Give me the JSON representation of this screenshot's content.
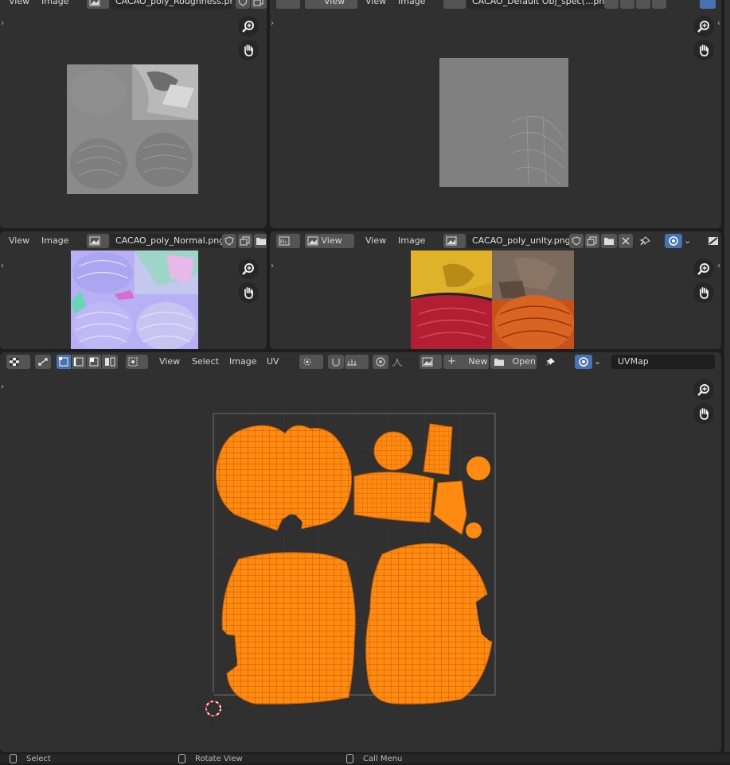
{
  "colors": {
    "uv_fill": "#ff8a12",
    "uv_edge": "#c45c00",
    "canvas": "#303030",
    "header": "#303030",
    "accent_blue": "#4772b3"
  },
  "panels": {
    "roughness": {
      "menus": [
        "View",
        "Image"
      ],
      "image_name": "CACAO_poly_Roughness.png"
    },
    "specular": {
      "menus": [
        "View",
        "Image"
      ],
      "view_dropdown": "View",
      "image_name": "CACAO_Default Obj_spec(...png"
    },
    "normal": {
      "menus": [
        "View",
        "Image"
      ],
      "image_name": "CACAO_poly_Normal.png"
    },
    "unity": {
      "menus": [
        "View",
        "Image"
      ],
      "view_dropdown": "View",
      "image_name": "CACAO_poly_unity.png"
    },
    "uv_editor": {
      "menus": [
        "View",
        "Select",
        "Image",
        "UV"
      ],
      "new_label": "New",
      "open_label": "Open",
      "uvmap_value": "UVMap"
    }
  },
  "status_bar": {
    "items": [
      "Select",
      "Rotate View",
      "Call Menu"
    ]
  },
  "icons": [
    "zoom-icon",
    "hand-icon",
    "image-icon",
    "shield-icon",
    "copy-icon",
    "folder-icon",
    "close-icon",
    "pin-icon",
    "overlay-icon",
    "cursor-icon"
  ]
}
